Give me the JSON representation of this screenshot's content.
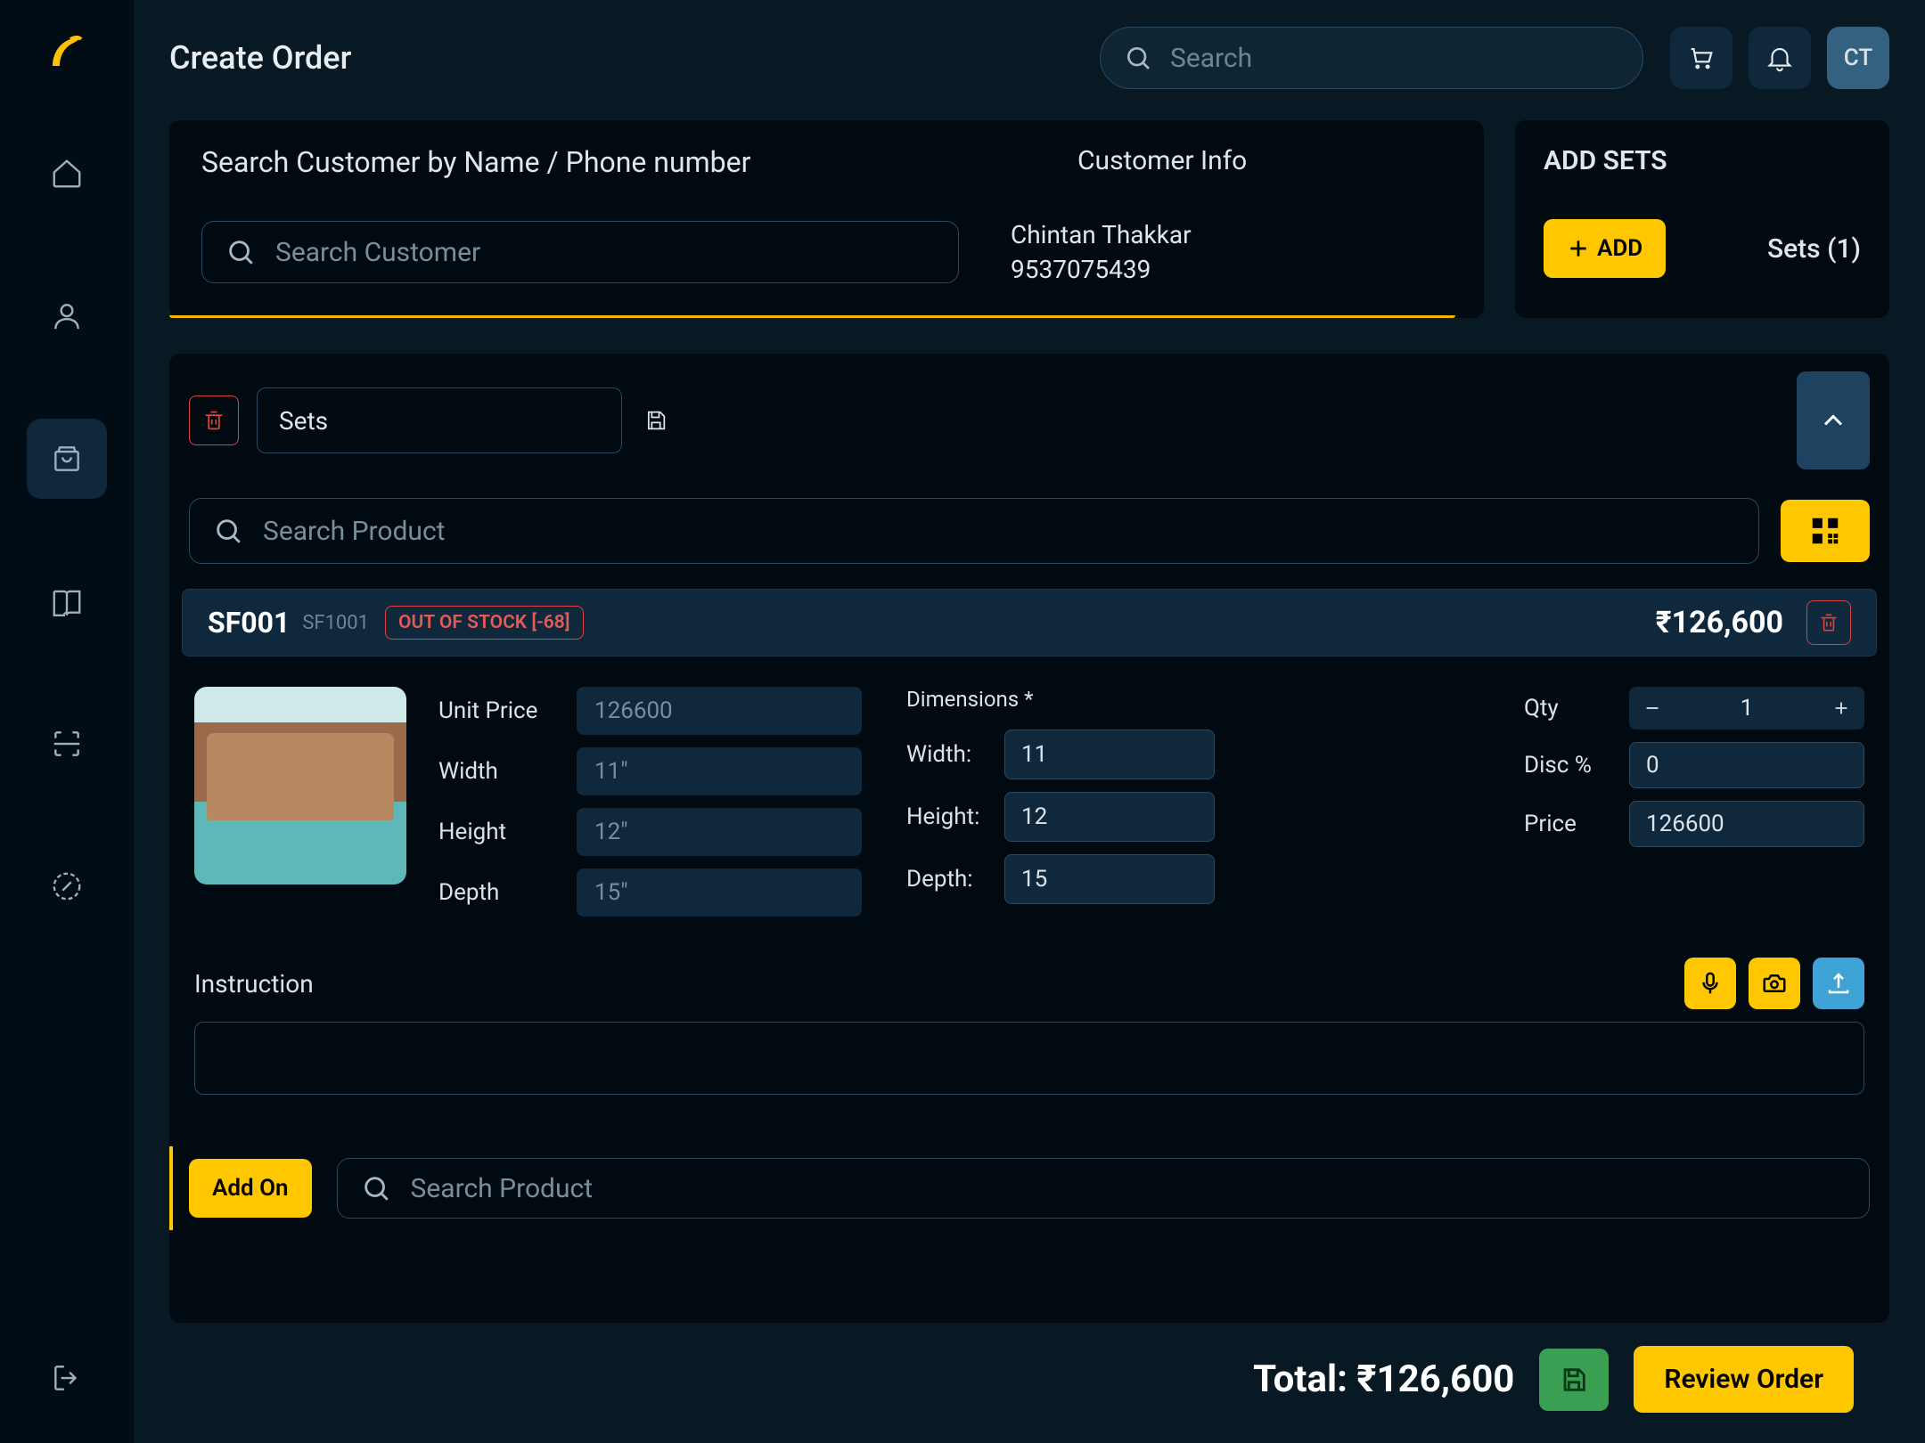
{
  "header": {
    "title": "Create Order",
    "search_placeholder": "Search",
    "avatar": "CT"
  },
  "customer_panel": {
    "title": "Search Customer by Name / Phone number",
    "info_title": "Customer Info",
    "search_placeholder": "Search Customer",
    "name": "Chintan Thakkar",
    "phone": "9537075439"
  },
  "sets_panel": {
    "title": "ADD SETS",
    "add_label": "ADD",
    "count_label": "Sets (1)"
  },
  "set": {
    "name": "Sets",
    "product_search_placeholder": "Search Product",
    "product": {
      "code": "SF001",
      "sku": "SF1001",
      "stock_status": "OUT OF STOCK [-68]",
      "price_display": "₹126,600",
      "labels": {
        "unit_price": "Unit Price",
        "width": "Width",
        "height": "Height",
        "depth": "Depth",
        "dimensions": "Dimensions *",
        "dim_width": "Width:",
        "dim_height": "Height:",
        "dim_depth": "Depth:",
        "qty": "Qty",
        "disc": "Disc %",
        "price": "Price",
        "instruction": "Instruction"
      },
      "readonly": {
        "unit_price": "126600",
        "width": "11\"",
        "height": "12\"",
        "depth": "15\""
      },
      "dimensions": {
        "width": "11",
        "height": "12",
        "depth": "15"
      },
      "qty": "1",
      "disc": "0",
      "price": "126600"
    }
  },
  "addon": {
    "button": "Add On",
    "search_placeholder": "Search Product"
  },
  "footer": {
    "total_display": "Total: ₹126,600",
    "review_label": "Review Order"
  }
}
